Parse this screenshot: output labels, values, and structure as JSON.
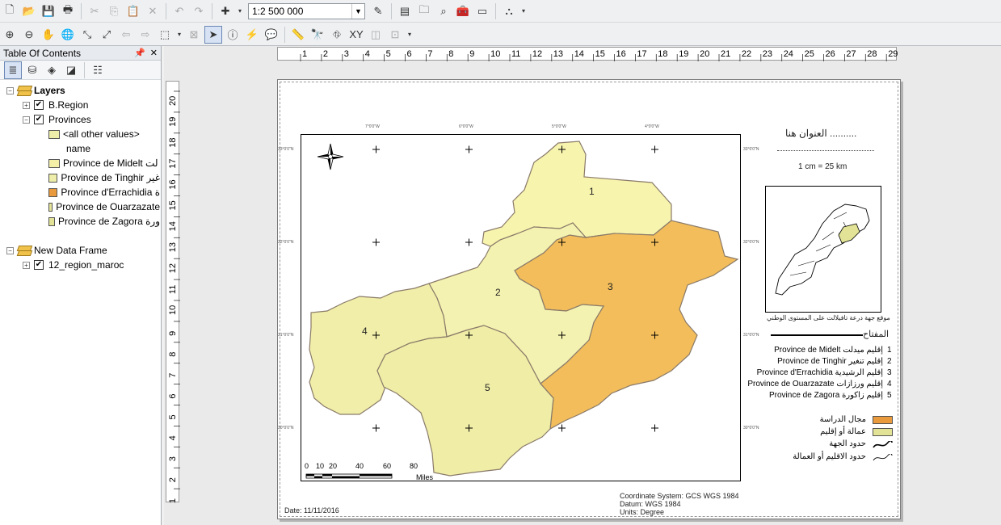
{
  "toolbar": {
    "scale_value": "1:2 500 000"
  },
  "toc": {
    "title": "Table Of Contents",
    "layers_label": "Layers",
    "b_region_label": "B.Region",
    "provinces_label": "Provinces",
    "other_values_label": "<all other values>",
    "field_label": "name",
    "province_items": [
      {
        "label": "Province de Midelt لت",
        "color": "#f5f0a8"
      },
      {
        "label": "Province de Tinghir غير",
        "color": "#eeeeaa"
      },
      {
        "label": "Province d'Errachidia ة",
        "color": "#e89a3c"
      },
      {
        "label": "Province de Ouarzazate",
        "color": "#e5e59a"
      },
      {
        "label": "Province de Zagora ورة",
        "color": "#e2e396"
      }
    ],
    "new_data_frame_label": "New Data Frame",
    "region_layer_label": "12_region_maroc"
  },
  "ruler": {
    "h_ticks": [
      "1",
      "2",
      "3",
      "4",
      "5",
      "6",
      "7",
      "8",
      "9",
      "10",
      "11",
      "12",
      "13",
      "14",
      "15",
      "16",
      "17",
      "18",
      "19",
      "20",
      "21",
      "22",
      "23",
      "24",
      "25",
      "26",
      "27",
      "28",
      "29"
    ],
    "v_ticks": [
      "20",
      "19",
      "18",
      "17",
      "16",
      "15",
      "14",
      "13",
      "12",
      "11",
      "10",
      "9",
      "8",
      "7",
      "6",
      "5",
      "4",
      "3",
      "2",
      "1"
    ]
  },
  "map": {
    "title_placeholder": "العنوان هنا ..........",
    "scale_text": "1 cm = 25 km",
    "inset_caption": "موقع جهة درعة تافيلالت على المستوى الوطني",
    "legend_heading": "المفتاح",
    "legend_items": [
      {
        "num": "1",
        "text": "Province de Midelt إقليم ميدلت"
      },
      {
        "num": "2",
        "text": "Province de Tinghir إقليم تنغير"
      },
      {
        "num": "3",
        "text": "Province d'Errachidia إقليم الرشيدية"
      },
      {
        "num": "4",
        "text": "Province de Ouarzazate إقليم ورزازات"
      },
      {
        "num": "5",
        "text": "Province de Zagora إقليم زاكورة"
      }
    ],
    "symbol_legend": [
      {
        "text": "مجال الدراسة",
        "color": "#e89a3c"
      },
      {
        "text": "عمالة أو إقليم",
        "color": "#e2e396"
      },
      {
        "text": "حدود الجهة",
        "color": ""
      },
      {
        "text": "حدود الاقليم أو العمالة",
        "color": ""
      }
    ],
    "scale_bar_labels": [
      "0",
      "10",
      "20",
      "40",
      "60",
      "80"
    ],
    "scale_bar_unit": "Miles",
    "coord_system": "Coordinate System: GCS WGS 1984",
    "datum": "Datum: WGS 1984",
    "units": "Units: Degree",
    "date": "Date: 11/11/2016",
    "province_numbers": [
      "1",
      "2",
      "3",
      "4",
      "5"
    ]
  }
}
